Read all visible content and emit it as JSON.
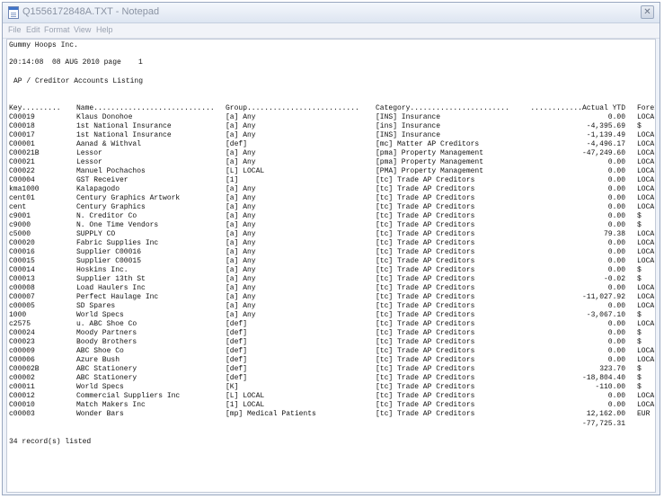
{
  "window": {
    "title": "Q1556172848A.TXT - Notepad",
    "close_glyph": "✕"
  },
  "menu": [
    "File",
    "Edit",
    "Format",
    "View",
    "Help"
  ],
  "report": {
    "company": "Gummy Hoops Inc.",
    "time_line": "20:14:08  08 AUG 2010 page    1",
    "report_title": "AP / Creditor Accounts Listing",
    "headers": {
      "key": "Key.........",
      "name": "Name............................",
      "group": "Group..........................",
      "category": "Category.......................",
      "ytd": "............Actual YTD",
      "forex": "Forex."
    },
    "rows": [
      {
        "key": "C00019",
        "name": "Klaus Donohoe",
        "group": "[a] Any",
        "category": "[INS] Insurance",
        "ytd": "0.00",
        "forex": "LOCAL"
      },
      {
        "key": "C00018",
        "name": "1st National Insurance",
        "group": "[a] Any",
        "category": "[ins] Insurance",
        "ytd": "-4,395.69",
        "forex": "$"
      },
      {
        "key": "C00017",
        "name": "1st National Insurance",
        "group": "[a] Any",
        "category": "[INS] Insurance",
        "ytd": "-1,139.49",
        "forex": "LOCAL"
      },
      {
        "key": "C00001",
        "name": "Aanad & Withval",
        "group": "[def]",
        "category": "[mc] Matter AP Creditors",
        "ytd": "-4,496.17",
        "forex": "LOCAL"
      },
      {
        "key": "C00021B",
        "name": "Lessor",
        "group": "[a] Any",
        "category": "[pma] Property Management",
        "ytd": "-47,249.60",
        "forex": "LOCAL"
      },
      {
        "key": "C00021",
        "name": "Lessor",
        "group": "[a] Any",
        "category": "[pma] Property Management",
        "ytd": "0.00",
        "forex": "LOCAL"
      },
      {
        "key": "C00022",
        "name": "Manuel Pochachos",
        "group": "[L] LOCAL",
        "category": "[PMA] Property Management",
        "ytd": "0.00",
        "forex": "LOCAL"
      },
      {
        "key": "C00004",
        "name": "GST Receiver",
        "group": "[1]",
        "category": "[tc] Trade AP Creditors",
        "ytd": "0.00",
        "forex": "LOCAL"
      },
      {
        "key": "kma1000",
        "name": "Kalapagodo",
        "group": "[a] Any",
        "category": "[tc] Trade AP Creditors",
        "ytd": "0.00",
        "forex": "LOCAL"
      },
      {
        "key": "cent01",
        "name": "Century Graphics Artwork",
        "group": "[a] Any",
        "category": "[tc] Trade AP Creditors",
        "ytd": "0.00",
        "forex": "LOCAL"
      },
      {
        "key": "cent",
        "name": "Century Graphics",
        "group": "[a] Any",
        "category": "[tc] Trade AP Creditors",
        "ytd": "0.00",
        "forex": "LOCAL"
      },
      {
        "key": "c9001",
        "name": "N. Creditor Co",
        "group": "[a] Any",
        "category": "[tc] Trade AP Creditors",
        "ytd": "0.00",
        "forex": "$"
      },
      {
        "key": "c9000",
        "name": "N. One Time Vendors",
        "group": "[a] Any",
        "category": "[tc] Trade AP Creditors",
        "ytd": "0.00",
        "forex": "$"
      },
      {
        "key": "c5000",
        "name": "SUPPLY CO",
        "group": "[a] Any",
        "category": "[tc] Trade AP Creditors",
        "ytd": "79.38",
        "forex": "LOCAL"
      },
      {
        "key": "C00020",
        "name": "Fabric Supplies Inc",
        "group": "[a] Any",
        "category": "[tc] Trade AP Creditors",
        "ytd": "0.00",
        "forex": "LOCAL"
      },
      {
        "key": "C00016",
        "name": "Supplier C00016",
        "group": "[a] Any",
        "category": "[tc] Trade AP Creditors",
        "ytd": "0.00",
        "forex": "LOCAL"
      },
      {
        "key": "C00015",
        "name": "Supplier C00015",
        "group": "[a] Any",
        "category": "[tc] Trade AP Creditors",
        "ytd": "0.00",
        "forex": "LOCAL"
      },
      {
        "key": "C00014",
        "name": "Hoskins Inc.",
        "group": "[a] Any",
        "category": "[tc] Trade AP Creditors",
        "ytd": "0.00",
        "forex": "$"
      },
      {
        "key": "C00013",
        "name": "Supplier 13th St",
        "group": "[a] Any",
        "category": "[tc] Trade AP Creditors",
        "ytd": "-0.02",
        "forex": "$"
      },
      {
        "key": "c00008",
        "name": "Load Haulers Inc",
        "group": "[a] Any",
        "category": "[tc] Trade AP Creditors",
        "ytd": "0.00",
        "forex": "LOCAL"
      },
      {
        "key": "C00007",
        "name": "Perfect Haulage Inc",
        "group": "[a] Any",
        "category": "[tc] Trade AP Creditors",
        "ytd": "-11,027.92",
        "forex": "LOCAL"
      },
      {
        "key": "c00005",
        "name": "SD Spares",
        "group": "[a] Any",
        "category": "[tc] Trade AP Creditors",
        "ytd": "0.00",
        "forex": "LOCAL"
      },
      {
        "key": "1000",
        "name": "World Specs",
        "group": "[a] Any",
        "category": "[tc] Trade AP Creditors",
        "ytd": "-3,067.10",
        "forex": "$"
      },
      {
        "key": "c2575",
        "name": "u. ABC Shoe Co",
        "group": "[def]",
        "category": "[tc] Trade AP Creditors",
        "ytd": "0.00",
        "forex": "LOCAL"
      },
      {
        "key": "C00024",
        "name": "Moody Partners",
        "group": "[def]",
        "category": "[tc] Trade AP Creditors",
        "ytd": "0.00",
        "forex": "$"
      },
      {
        "key": "C00023",
        "name": "Boody Brothers",
        "group": "[def]",
        "category": "[tc] Trade AP Creditors",
        "ytd": "0.00",
        "forex": "$"
      },
      {
        "key": "c00009",
        "name": "ABC Shoe Co",
        "group": "[def]",
        "category": "[tc] Trade AP Creditors",
        "ytd": "0.00",
        "forex": "LOCAL"
      },
      {
        "key": "C00006",
        "name": "Azure Bush",
        "group": "[def]",
        "category": "[tc] Trade AP Creditors",
        "ytd": "0.00",
        "forex": "LOCAL"
      },
      {
        "key": "C00002B",
        "name": "ABC Stationery",
        "group": "[def]",
        "category": "[tc] Trade AP Creditors",
        "ytd": "323.70",
        "forex": "$"
      },
      {
        "key": "c00002",
        "name": "ABC Stationery",
        "group": "[def]",
        "category": "[tc] Trade AP Creditors",
        "ytd": "-18,804.40",
        "forex": "$"
      },
      {
        "key": "c00011",
        "name": "World Specs",
        "group": "[K]",
        "category": "[tc] Trade AP Creditors",
        "ytd": "-110.00",
        "forex": "$"
      },
      {
        "key": "C00012",
        "name": "Commercial Suppliers Inc",
        "group": "[L] LOCAL",
        "category": "[tc] Trade AP Creditors",
        "ytd": "0.00",
        "forex": "LOCAL"
      },
      {
        "key": "C00010",
        "name": "Match Makers Inc",
        "group": "[1] LOCAL",
        "category": "[tc] Trade AP Creditors",
        "ytd": "0.00",
        "forex": "LOCAL"
      },
      {
        "key": "c00003",
        "name": "Wonder Bars",
        "group": "[mp] Medical Patients",
        "category": "[tc] Trade AP Creditors",
        "ytd": "12,162.00",
        "forex": "EUR"
      }
    ],
    "total": "-77,725.31",
    "footer": "34 record(s) listed"
  }
}
